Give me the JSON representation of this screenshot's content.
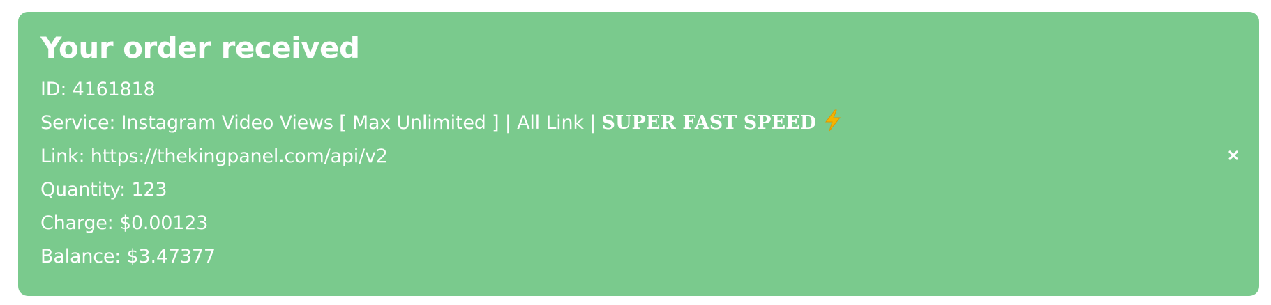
{
  "alert": {
    "title": "Your order received",
    "id_line": "ID: 4161818",
    "service_prefix": "Service: Instagram Video Views [ Max Unlimited ] | All Link | ",
    "service_speed": "SUPER FAST SPEED",
    "service_icon": "lightning-bolt-icon",
    "link_line": "Link: https://thekingpanel.com/api/v2",
    "quantity_line": "Quantity: 123",
    "charge_line": "Charge: $0.00123",
    "balance_line": "Balance: $3.47377",
    "close_icon": "close-icon",
    "colors": {
      "background": "#7aca8d",
      "text": "#ffffff",
      "bolt": "#f5b400"
    }
  }
}
